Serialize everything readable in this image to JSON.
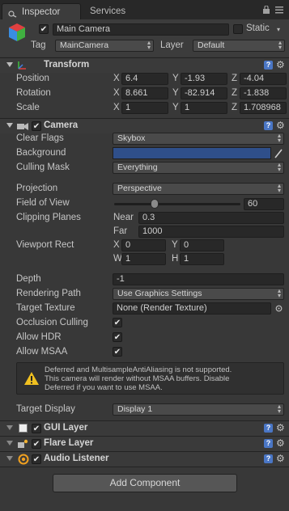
{
  "tabs": {
    "inspector": "Inspector",
    "services": "Services"
  },
  "object": {
    "name": "Main Camera",
    "static_label": "Static",
    "tag_label": "Tag",
    "tag_value": "MainCamera",
    "layer_label": "Layer",
    "layer_value": "Default"
  },
  "transform": {
    "title": "Transform",
    "position": {
      "label": "Position",
      "x": "6.4",
      "y": "-1.93",
      "z": "-4.04"
    },
    "rotation": {
      "label": "Rotation",
      "x": "8.661",
      "y": "-82.914",
      "z": "-1.838"
    },
    "scale": {
      "label": "Scale",
      "x": "1",
      "y": "1",
      "z": "1.708968"
    },
    "axis_x": "X",
    "axis_y": "Y",
    "axis_z": "Z"
  },
  "camera": {
    "title": "Camera",
    "clear_flags": {
      "label": "Clear Flags",
      "value": "Skybox"
    },
    "background": {
      "label": "Background",
      "color": "#2f4f8a"
    },
    "culling_mask": {
      "label": "Culling Mask",
      "value": "Everything"
    },
    "projection": {
      "label": "Projection",
      "value": "Perspective"
    },
    "fov": {
      "label": "Field of View",
      "value": "60"
    },
    "clipping": {
      "label": "Clipping Planes",
      "near_label": "Near",
      "near": "0.3",
      "far_label": "Far",
      "far": "1000"
    },
    "viewport": {
      "label": "Viewport Rect",
      "x_label": "X",
      "x": "0",
      "y_label": "Y",
      "y": "0",
      "w_label": "W",
      "w": "1",
      "h_label": "H",
      "h": "1"
    },
    "depth": {
      "label": "Depth",
      "value": "-1"
    },
    "rendering_path": {
      "label": "Rendering Path",
      "value": "Use Graphics Settings"
    },
    "target_texture": {
      "label": "Target Texture",
      "value": "None (Render Texture)"
    },
    "occlusion": {
      "label": "Occlusion Culling"
    },
    "hdr": {
      "label": "Allow HDR"
    },
    "msaa": {
      "label": "Allow MSAA"
    },
    "warning_lines": [
      "Deferred and MultisampleAntiAliasing is not supported.",
      "This camera will render without MSAA buffers. Disable",
      "Deferred if you want to use MSAA."
    ],
    "target_display": {
      "label": "Target Display",
      "value": "Display 1"
    }
  },
  "components": {
    "gui_layer": "GUI Layer",
    "flare_layer": "Flare Layer",
    "audio_listener": "Audio Listener"
  },
  "add_component": "Add Component",
  "colors": {
    "accent_blue": "#4a76c5",
    "panel": "#383838",
    "field": "#282828"
  }
}
